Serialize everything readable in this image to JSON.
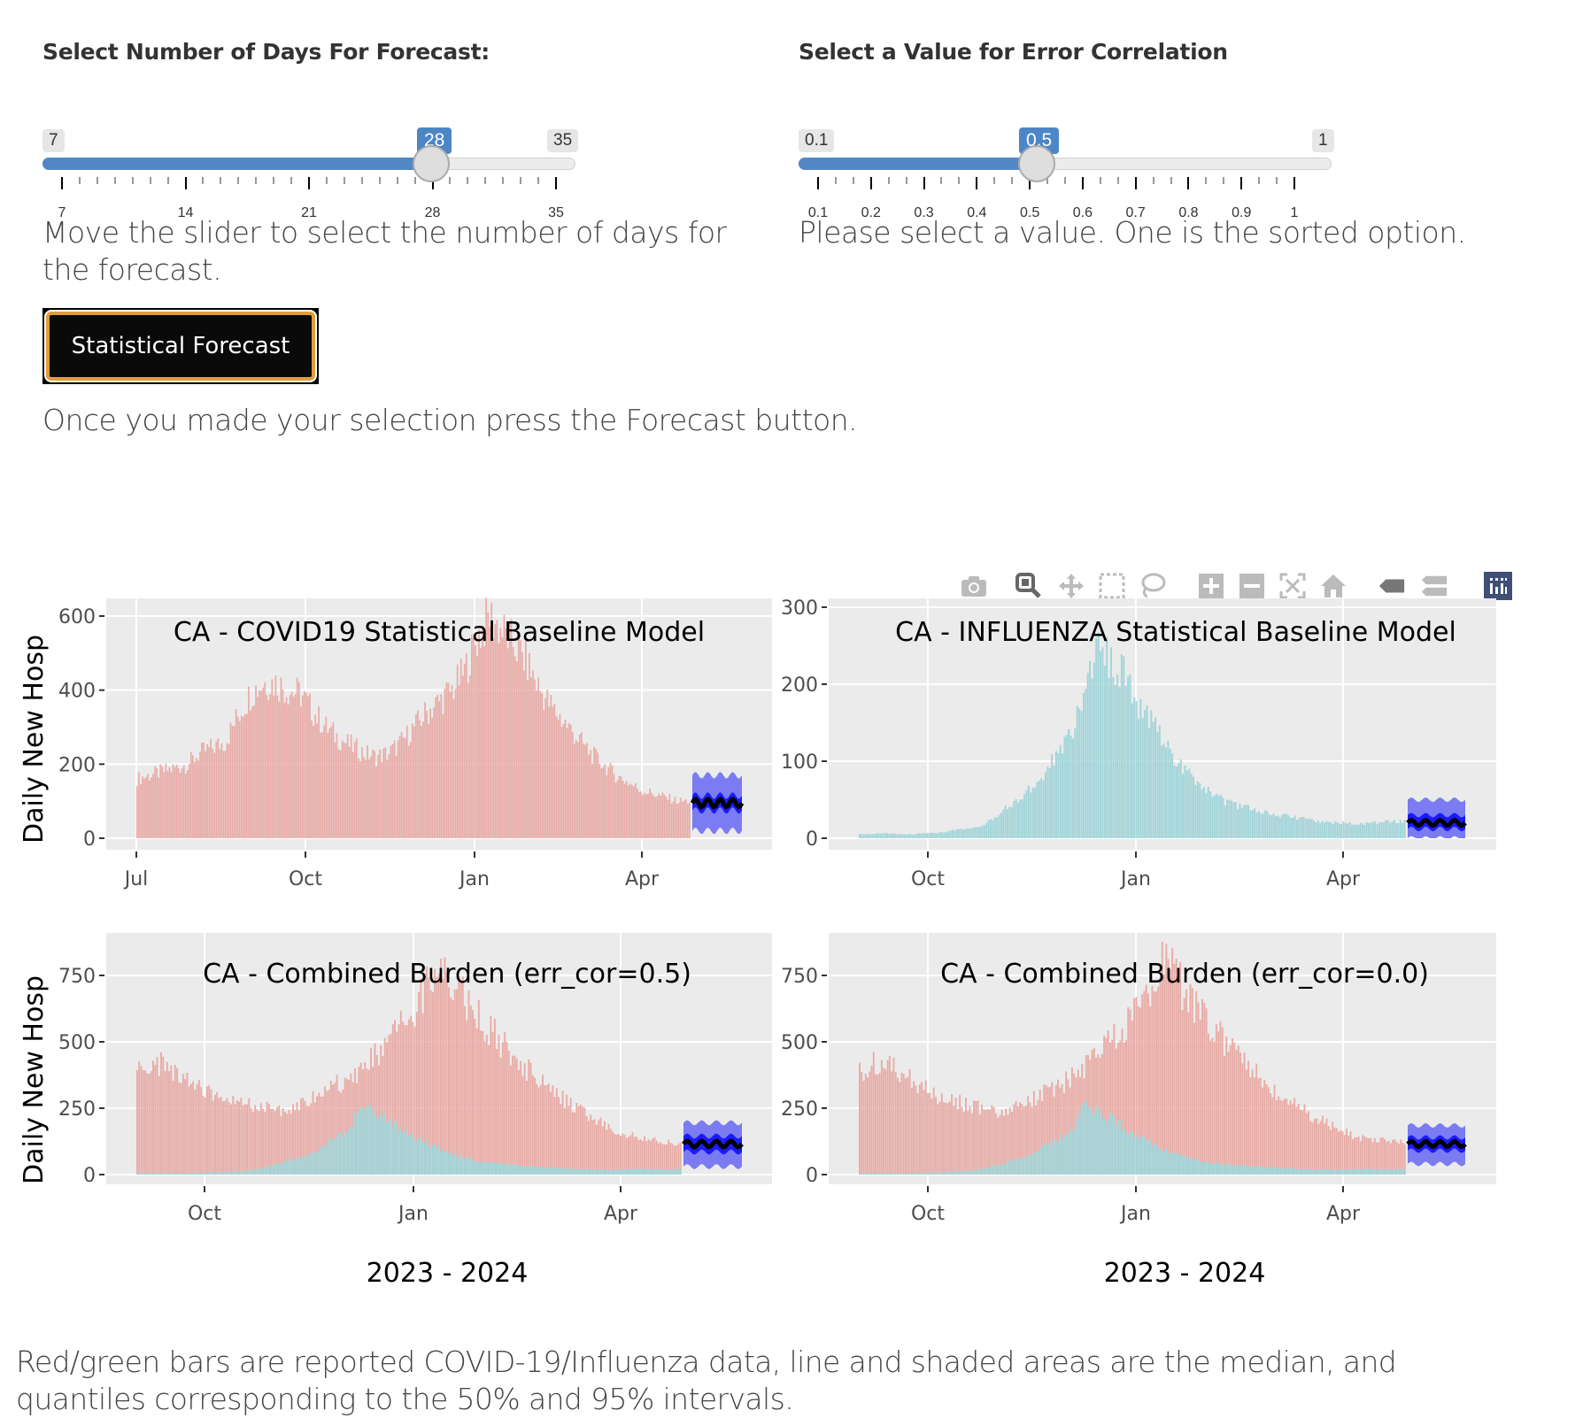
{
  "controls": {
    "days_slider": {
      "label": "Select Number of Days For Forecast:",
      "min": 7,
      "max": 35,
      "value": 28,
      "min_label": "7",
      "max_label": "35",
      "value_label": "28",
      "tick_labels": [
        "7",
        "14",
        "21",
        "28",
        "35"
      ],
      "help": "Move the slider to select the number of days for the forecast."
    },
    "corr_slider": {
      "label": "Select a Value for Error Correlation",
      "min": 0.1,
      "max": 1,
      "value": 0.5,
      "min_label": "0.1",
      "max_label": "1",
      "value_label": "0.5",
      "tick_labels": [
        "0.1",
        "0.2",
        "0.3",
        "0.4",
        "0.5",
        "0.6",
        "0.7",
        "0.8",
        "0.9",
        "1"
      ],
      "help": "Please select a value. One is the sorted option."
    },
    "forecast_button": {
      "label": "Statistical Forecast"
    },
    "button_help": "Once you made your selection press the Forecast button."
  },
  "modebar": {
    "icons": [
      "camera-icon",
      "zoom-icon",
      "pan-icon",
      "box-select-icon",
      "lasso-select-icon",
      "zoom-in-icon",
      "zoom-out-icon",
      "autoscale-icon",
      "reset-axes-icon",
      "hover-closest-icon",
      "hover-compare-icon",
      "plotly-logo-icon"
    ],
    "active": "zoom-icon"
  },
  "colors": {
    "covid": "#e8a9a3",
    "flu": "#9fd4d8",
    "ci95": "#7b7bf2",
    "ci50": "#1a1aff",
    "median": "#000000",
    "panel_bg": "#ebebeb",
    "slider_accent": "#5287c6",
    "button_border": "#e09e37"
  },
  "caption": "Red/green bars are reported COVID-19/Influenza data, line and shaded areas are the median, and quantiles corresponding to the 50% and 95% intervals.",
  "chart_data": [
    {
      "type": "bar",
      "title": "CA - COVID19 Statistical Baseline Model",
      "ylabel": "Daily New Hosp",
      "xlabel": "",
      "ylim": [
        0,
        640
      ],
      "yticks": [
        0,
        200,
        400,
        600
      ],
      "xtick_labels": [
        "Jul",
        "Oct",
        "Jan",
        "Apr"
      ],
      "grid": true,
      "x_unit": "week index from Jul 1 2023",
      "series": [
        {
          "name": "COVID-19 reported",
          "color_key": "covid",
          "values": [
            160,
            170,
            180,
            190,
            200,
            230,
            245,
            260,
            330,
            390,
            420,
            420,
            400,
            390,
            340,
            300,
            270,
            250,
            230,
            220,
            230,
            260,
            300,
            340,
            370,
            400,
            450,
            540,
            600,
            560,
            520,
            470,
            400,
            350,
            310,
            270,
            230,
            200,
            170,
            150,
            130,
            120,
            110,
            100
          ]
        }
      ],
      "forecast": {
        "weeks": 4,
        "median": 95,
        "q50": [
          75,
          115
        ],
        "q95": [
          20,
          170
        ]
      }
    },
    {
      "type": "bar",
      "title": "CA - INFLUENZA Statistical Baseline Model",
      "ylabel": "",
      "xlabel": "",
      "ylim": [
        0,
        305
      ],
      "yticks": [
        0,
        100,
        200,
        300
      ],
      "xtick_labels": [
        "Oct",
        "Jan",
        "Apr"
      ],
      "grid": true,
      "x_unit": "week index from Sep 1 2023",
      "series": [
        {
          "name": "Influenza reported",
          "color_key": "flu",
          "values": [
            5,
            6,
            6,
            5,
            6,
            7,
            9,
            12,
            15,
            25,
            40,
            55,
            70,
            100,
            130,
            165,
            260,
            230,
            210,
            170,
            140,
            110,
            90,
            70,
            55,
            45,
            40,
            35,
            32,
            28,
            25,
            22,
            20,
            20,
            18,
            20,
            22
          ]
        }
      ],
      "forecast": {
        "weeks": 4,
        "median": 20,
        "q50": [
          12,
          30
        ],
        "q95": [
          0,
          50
        ]
      }
    },
    {
      "type": "bar",
      "title": "CA - Combined Burden (err_cor=0.5)",
      "ylabel": "Daily New Hosp",
      "xlabel": "2023 - 2024",
      "ylim": [
        0,
        870
      ],
      "yticks": [
        0,
        250,
        500,
        750
      ],
      "xtick_labels": [
        "Oct",
        "Jan",
        "Apr"
      ],
      "grid": true,
      "x_unit": "week index from Sep 1 2023",
      "series": [
        {
          "name": "COVID-19 reported",
          "color_key": "covid",
          "values": [
            390,
            420,
            410,
            380,
            350,
            310,
            290,
            270,
            260,
            250,
            240,
            250,
            270,
            300,
            330,
            360,
            400,
            450,
            500,
            560,
            620,
            760,
            800,
            700,
            620,
            560,
            500,
            440,
            390,
            340,
            300,
            260,
            230,
            200,
            170,
            150,
            140,
            130,
            120
          ]
        },
        {
          "name": "Influenza reported",
          "color_key": "flu",
          "values": [
            5,
            6,
            6,
            5,
            6,
            7,
            9,
            12,
            15,
            25,
            40,
            55,
            70,
            100,
            130,
            165,
            260,
            230,
            210,
            170,
            140,
            110,
            90,
            70,
            55,
            45,
            40,
            35,
            32,
            28,
            25,
            22,
            20,
            20,
            18,
            20,
            22,
            20,
            20
          ]
        }
      ],
      "forecast": {
        "weeks": 4,
        "median": 115,
        "q50": [
          85,
          145
        ],
        "q95": [
          30,
          195
        ]
      }
    },
    {
      "type": "bar",
      "title": "CA - Combined Burden (err_cor=0.0)",
      "ylabel": "",
      "xlabel": "2023 - 2024",
      "ylim": [
        0,
        870
      ],
      "yticks": [
        0,
        250,
        500,
        750
      ],
      "xtick_labels": [
        "Oct",
        "Jan",
        "Apr"
      ],
      "grid": true,
      "x_unit": "week index from Sep 1 2023",
      "series": [
        {
          "name": "COVID-19 reported",
          "color_key": "covid",
          "values": [
            390,
            420,
            410,
            380,
            350,
            310,
            290,
            270,
            260,
            250,
            240,
            250,
            270,
            300,
            330,
            360,
            400,
            450,
            500,
            560,
            620,
            760,
            800,
            700,
            620,
            560,
            500,
            440,
            390,
            340,
            300,
            260,
            230,
            200,
            170,
            150,
            140,
            130,
            120
          ]
        },
        {
          "name": "Influenza reported",
          "color_key": "flu",
          "values": [
            5,
            6,
            6,
            5,
            6,
            7,
            9,
            12,
            15,
            25,
            40,
            55,
            70,
            100,
            130,
            165,
            260,
            230,
            210,
            170,
            140,
            110,
            90,
            70,
            55,
            45,
            40,
            35,
            32,
            28,
            25,
            22,
            20,
            20,
            18,
            20,
            22,
            20,
            20
          ]
        }
      ],
      "forecast": {
        "weeks": 4,
        "median": 115,
        "q50": [
          90,
          140
        ],
        "q95": [
          40,
          185
        ]
      }
    }
  ]
}
